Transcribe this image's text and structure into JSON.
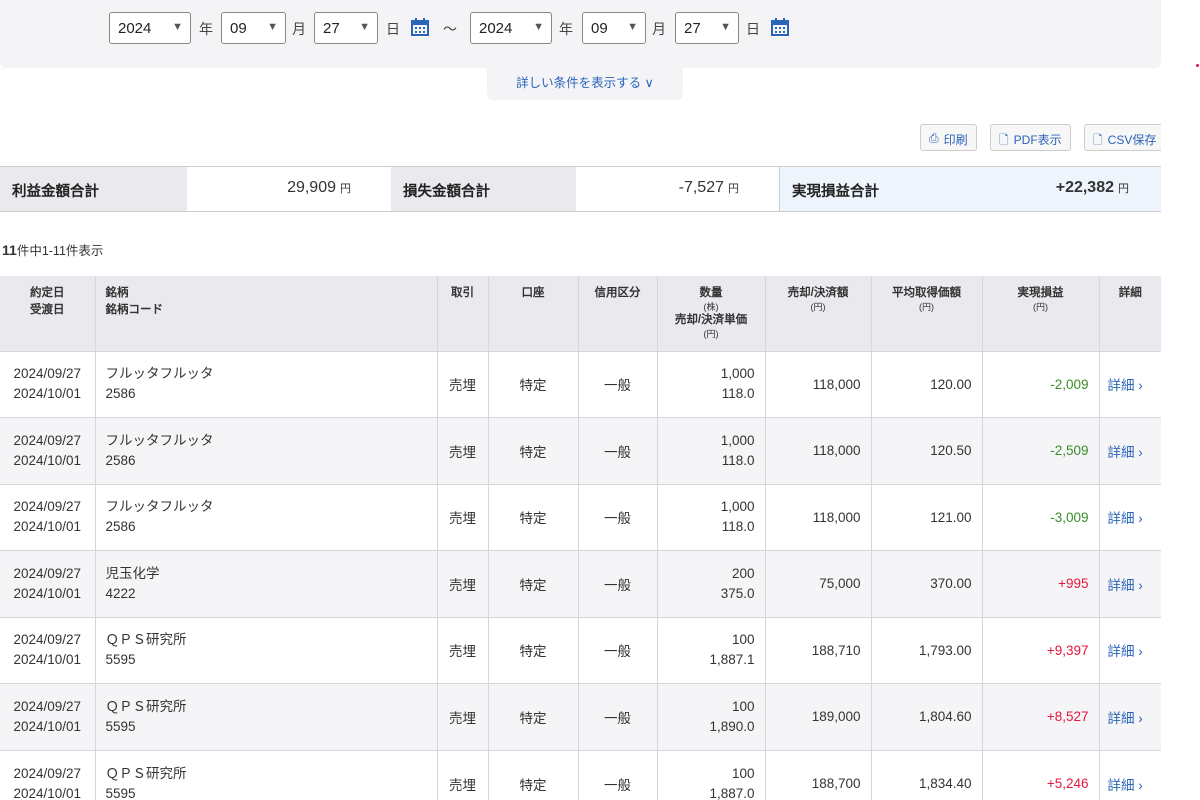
{
  "filter": {
    "from": {
      "year": "2024",
      "month": "09",
      "day": "27"
    },
    "to": {
      "year": "2024",
      "month": "09",
      "day": "27"
    },
    "year_label": "年",
    "month_label": "月",
    "day_label": "日",
    "tilde": "～",
    "more_label": "詳しい条件を表示する"
  },
  "actions": {
    "print": "印刷",
    "pdf": "PDF表示",
    "csv": "CSV保存"
  },
  "summary": {
    "profit_label": "利益金額合計",
    "profit_value": "29,909",
    "loss_label": "損失金額合計",
    "loss_value": "-7,527",
    "net_label": "実現損益合計",
    "net_value": "+22,382",
    "unit": "円"
  },
  "count": {
    "total": "11",
    "text": "件中1-11件表示"
  },
  "headers": {
    "date1": "約定日",
    "date2": "受渡日",
    "name1": "銘柄",
    "name2": "銘柄コード",
    "trade": "取引",
    "account": "口座",
    "margin": "信用区分",
    "qty": "数量",
    "qty_unit": "(株)",
    "price": "売却/決済単価",
    "yen": "(円)",
    "amount": "売却/決済額",
    "avg": "平均取得価額",
    "pl": "実現損益",
    "detail": "詳細"
  },
  "rows": [
    {
      "date": "2024/09/27",
      "settle": "2024/10/01",
      "name": "フルッタフルッタ",
      "code": "2586",
      "trade": "売埋",
      "account": "特定",
      "margin": "一般",
      "qty": "1,000",
      "price": "118.0",
      "amount": "118,000",
      "avg": "120.00",
      "pl": "-2,009",
      "detail": "詳細"
    },
    {
      "date": "2024/09/27",
      "settle": "2024/10/01",
      "name": "フルッタフルッタ",
      "code": "2586",
      "trade": "売埋",
      "account": "特定",
      "margin": "一般",
      "qty": "1,000",
      "price": "118.0",
      "amount": "118,000",
      "avg": "120.50",
      "pl": "-2,509",
      "detail": "詳細"
    },
    {
      "date": "2024/09/27",
      "settle": "2024/10/01",
      "name": "フルッタフルッタ",
      "code": "2586",
      "trade": "売埋",
      "account": "特定",
      "margin": "一般",
      "qty": "1,000",
      "price": "118.0",
      "amount": "118,000",
      "avg": "121.00",
      "pl": "-3,009",
      "detail": "詳細"
    },
    {
      "date": "2024/09/27",
      "settle": "2024/10/01",
      "name": "児玉化学",
      "code": "4222",
      "trade": "売埋",
      "account": "特定",
      "margin": "一般",
      "qty": "200",
      "price": "375.0",
      "amount": "75,000",
      "avg": "370.00",
      "pl": "+995",
      "detail": "詳細"
    },
    {
      "date": "2024/09/27",
      "settle": "2024/10/01",
      "name": "ＱＰＳ研究所",
      "code": "5595",
      "trade": "売埋",
      "account": "特定",
      "margin": "一般",
      "qty": "100",
      "price": "1,887.1",
      "amount": "188,710",
      "avg": "1,793.00",
      "pl": "+9,397",
      "detail": "詳細"
    },
    {
      "date": "2024/09/27",
      "settle": "2024/10/01",
      "name": "ＱＰＳ研究所",
      "code": "5595",
      "trade": "売埋",
      "account": "特定",
      "margin": "一般",
      "qty": "100",
      "price": "1,890.0",
      "amount": "189,000",
      "avg": "1,804.60",
      "pl": "+8,527",
      "detail": "詳細"
    },
    {
      "date": "2024/09/27",
      "settle": "2024/10/01",
      "name": "ＱＰＳ研究所",
      "code": "5595",
      "trade": "売埋",
      "account": "特定",
      "margin": "一般",
      "qty": "100",
      "price": "1,887.0",
      "amount": "188,700",
      "avg": "1,834.40",
      "pl": "+5,246",
      "detail": "詳細"
    }
  ]
}
